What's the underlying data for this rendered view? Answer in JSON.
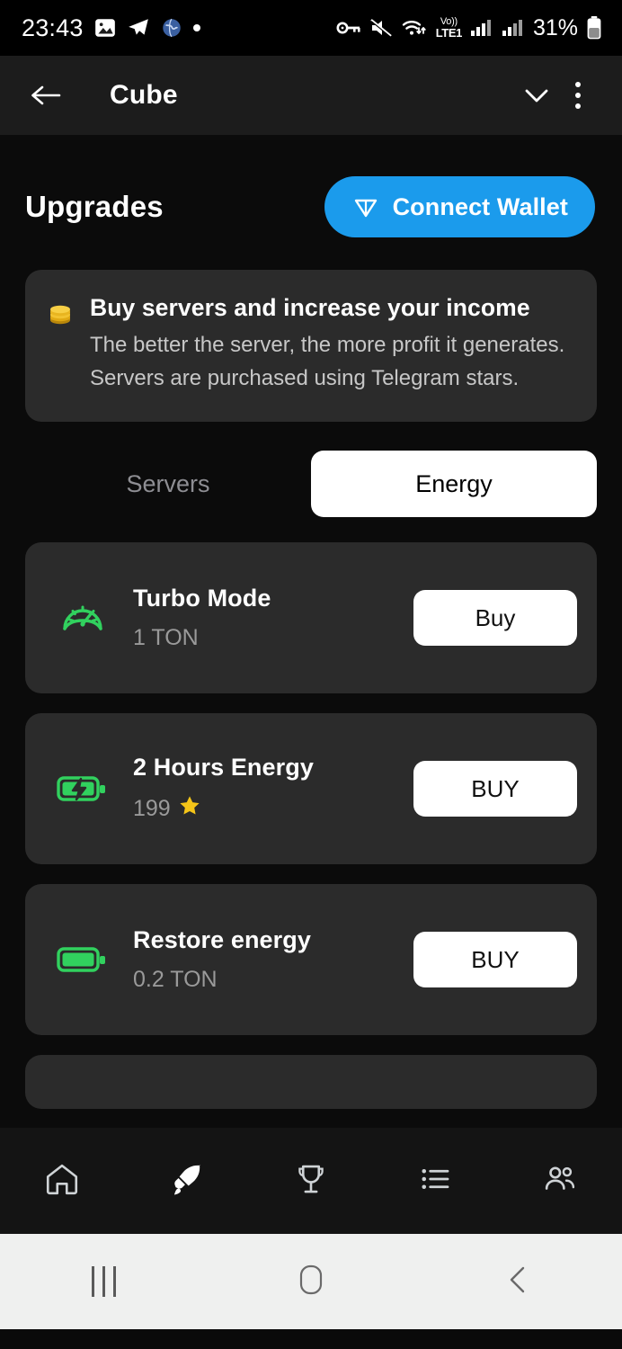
{
  "status_bar": {
    "time": "23:43",
    "left_icons": [
      "photo-icon",
      "telegram-icon",
      "globe-icon",
      "dot-icon"
    ],
    "right_icons": [
      "vpn-key-icon",
      "mute-icon",
      "wifi-icon",
      "volte-icon",
      "signal-icon-1",
      "signal-icon-2"
    ],
    "volte_top": "Vo))",
    "volte_bottom": "LTE1",
    "battery_percent": "31%"
  },
  "app_bar": {
    "title": "Cube",
    "back_icon": "back-arrow-icon",
    "expand_icon": "chevron-down-icon",
    "menu_icon": "more-vertical-icon"
  },
  "page": {
    "title": "Upgrades",
    "wallet_button": "Connect Wallet",
    "wallet_icon": "ton-diamond-icon",
    "accent_blue": "#1b9bec"
  },
  "info_card": {
    "icon": "coin-stack-icon",
    "title": "Buy servers and increase your income",
    "body": "The better the server, the more profit it generates. Servers are purchased using Telegram stars."
  },
  "tabs": [
    {
      "label": "Servers",
      "active": false
    },
    {
      "label": "Energy",
      "active": true
    }
  ],
  "items": [
    {
      "icon": "gauge-icon",
      "name": "Turbo Mode",
      "price": "1 TON",
      "price_suffix": "",
      "buy_label": "Buy"
    },
    {
      "icon": "battery-charging-icon",
      "name": "2 Hours Energy",
      "price": "199",
      "price_suffix": "star-icon",
      "buy_label": "BUY"
    },
    {
      "icon": "battery-full-icon",
      "name": "Restore energy",
      "price": "0.2 TON",
      "price_suffix": "",
      "buy_label": "BUY"
    }
  ],
  "bottom_nav": [
    {
      "icon": "home-icon",
      "active": false
    },
    {
      "icon": "rocket-icon",
      "active": true
    },
    {
      "icon": "trophy-icon",
      "active": false
    },
    {
      "icon": "list-icon",
      "active": false
    },
    {
      "icon": "friends-icon",
      "active": false
    }
  ],
  "system_bar": {
    "recents_icon": "recents-icon",
    "home_icon": "home-square-icon",
    "back_icon": "back-chevron-icon"
  },
  "colors": {
    "card_bg": "#2b2b2b",
    "icon_green": "#31d15e",
    "star_gold": "#f5c518",
    "muted_text": "#9a9a9a"
  }
}
